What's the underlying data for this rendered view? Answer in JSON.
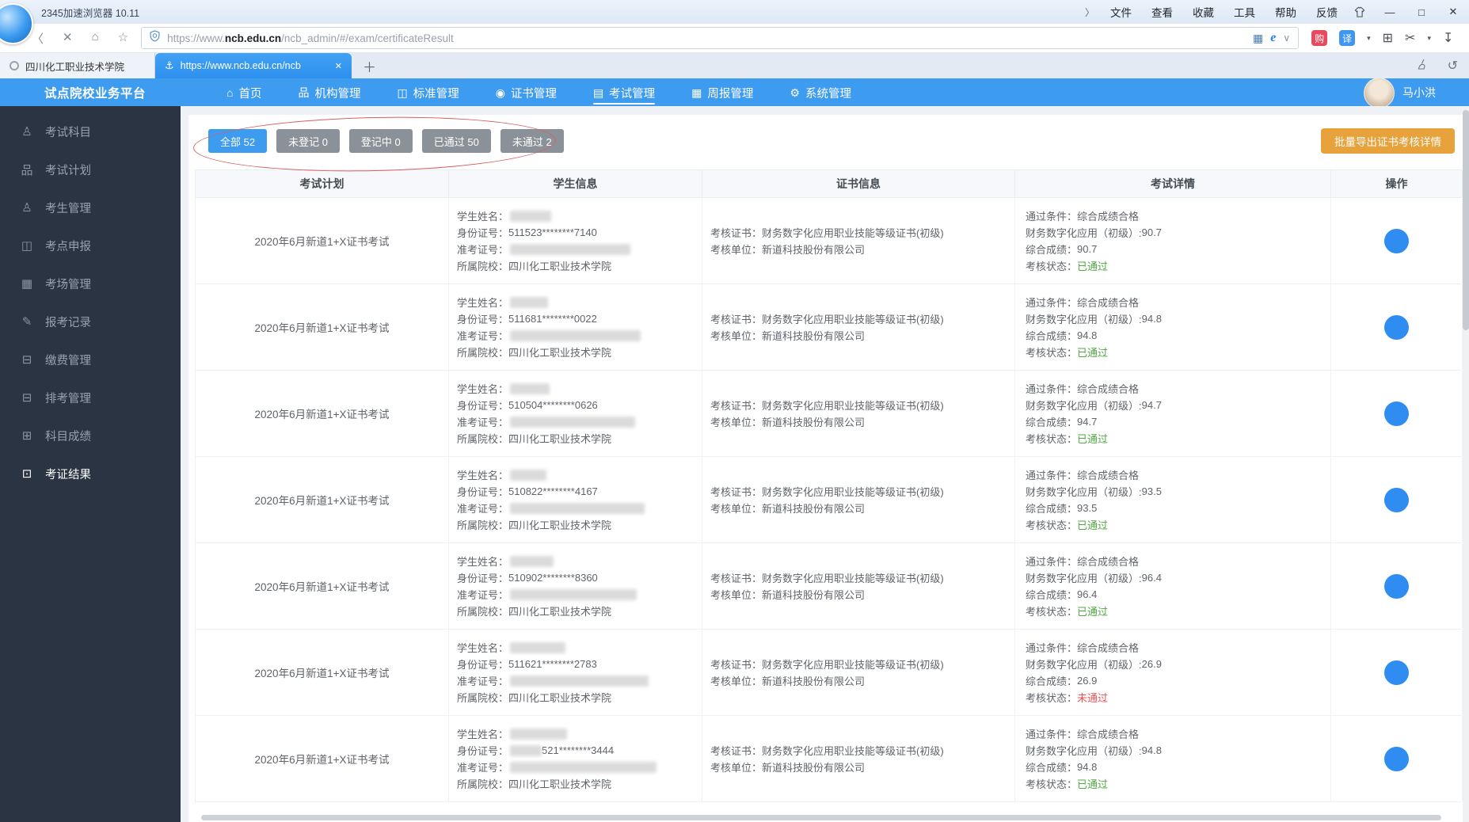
{
  "colors": {
    "accent": "#3d9bf0",
    "sidebar-bg": "#2b3442",
    "gray-btn": "#8b9198",
    "orange": "#e7a23c",
    "green": "#53a745",
    "red": "#f25050",
    "action": "#2f8df2",
    "annotation": "#d95f5f"
  },
  "browser": {
    "title": "2345加速浏览器 10.11",
    "menu_chevron": "〉",
    "menu_items": [
      "文件",
      "查看",
      "收藏",
      "工具",
      "帮助",
      "反馈"
    ],
    "window_controls": {
      "minimize": "—",
      "maximize": "□",
      "close": "✕"
    },
    "address": {
      "url_scheme": "https://www.",
      "url_domain": "ncb.edu.cn",
      "url_path": "/ncb_admin/#/exam/certificateResult"
    },
    "badges": {
      "buy": "购",
      "translate": "译"
    },
    "tabs": [
      {
        "title": "四川化工职业技术学院",
        "active": false,
        "closable": false
      },
      {
        "title": "https://www.ncb.edu.cn/ncb",
        "active": true,
        "closable": true
      }
    ]
  },
  "app": {
    "brand": "试点院校业务平台",
    "nav_items": [
      {
        "label": "首页",
        "icon": "home-icon",
        "active": false
      },
      {
        "label": "机构管理",
        "icon": "org-icon",
        "active": false
      },
      {
        "label": "标准管理",
        "icon": "standard-icon",
        "active": false
      },
      {
        "label": "证书管理",
        "icon": "certificate-icon",
        "active": false
      },
      {
        "label": "考试管理",
        "icon": "exam-icon",
        "active": true
      },
      {
        "label": "周报管理",
        "icon": "weekly-report-icon",
        "active": false
      },
      {
        "label": "系统管理",
        "icon": "gear-icon",
        "active": false
      }
    ],
    "user": {
      "name": "马小洪"
    }
  },
  "sidebar": {
    "items": [
      {
        "label": "考试科目",
        "icon": "user-icon",
        "active": false
      },
      {
        "label": "考试计划",
        "icon": "sitemap-icon",
        "active": false
      },
      {
        "label": "考生管理",
        "icon": "user-icon",
        "active": false
      },
      {
        "label": "考点申报",
        "icon": "book-icon",
        "active": false
      },
      {
        "label": "考场管理",
        "icon": "building-icon",
        "active": false
      },
      {
        "label": "报考记录",
        "icon": "user-edit-icon",
        "active": false
      },
      {
        "label": "缴费管理",
        "icon": "card-icon",
        "active": false
      },
      {
        "label": "排考管理",
        "icon": "card-icon",
        "active": false
      },
      {
        "label": "科目成绩",
        "icon": "grades-icon",
        "active": false
      },
      {
        "label": "考证结果",
        "icon": "board-icon",
        "active": true
      }
    ]
  },
  "filters": {
    "buttons": [
      {
        "label": "全部 52",
        "active": true
      },
      {
        "label": "未登记 0",
        "active": false
      },
      {
        "label": "登记中 0",
        "active": false
      },
      {
        "label": "已通过 50",
        "active": false
      },
      {
        "label": "未通过 2",
        "active": false
      }
    ]
  },
  "toolbar": {
    "export_label": "批量导出证书考核详情"
  },
  "table": {
    "headers": [
      "考试计划",
      "学生信息",
      "证书信息",
      "考试详情",
      "操作"
    ],
    "row_labels": {
      "name": "学生姓名：",
      "id": "身份证号：",
      "ticket": "准考证号：",
      "school": "所属院校：",
      "cert": "考核证书：",
      "org": "考核单位：",
      "condition": "通过条件： ",
      "subject": "财务数字化应用（初级）: ",
      "total": "综合成绩： ",
      "status": "考核状态："
    },
    "rows": [
      {
        "plan": "2020年6月新道1+X证书考试",
        "name_blur_w": 52,
        "id_prefix_blurred": false,
        "id_prefix_blur_w": 0,
        "id_number": "511523********7140",
        "ticket_blur_w": 152,
        "school": "四川化工职业技术学院",
        "cert": "财务数字化应用职业技能等级证书(初级)",
        "org": "新道科技股份有限公司",
        "pass_condition": "综合成绩合格",
        "subject_score": "90.7",
        "total_score": "90.7",
        "status": "已通过",
        "passed": true
      },
      {
        "plan": "2020年6月新道1+X证书考试",
        "name_blur_w": 48,
        "id_prefix_blurred": false,
        "id_prefix_blur_w": 0,
        "id_number": "511681********0022",
        "ticket_blur_w": 165,
        "school": "四川化工职业技术学院",
        "cert": "财务数字化应用职业技能等级证书(初级)",
        "org": "新道科技股份有限公司",
        "pass_condition": "综合成绩合格",
        "subject_score": "94.8",
        "total_score": "94.8",
        "status": "已通过",
        "passed": true
      },
      {
        "plan": "2020年6月新道1+X证书考试",
        "name_blur_w": 50,
        "id_prefix_blurred": false,
        "id_prefix_blur_w": 0,
        "id_number": "510504********0626",
        "ticket_blur_w": 158,
        "school": "四川化工职业技术学院",
        "cert": "财务数字化应用职业技能等级证书(初级)",
        "org": "新道科技股份有限公司",
        "pass_condition": "综合成绩合格",
        "subject_score": "94.7",
        "total_score": "94.7",
        "status": "已通过",
        "passed": true
      },
      {
        "plan": "2020年6月新道1+X证书考试",
        "name_blur_w": 46,
        "id_prefix_blurred": false,
        "id_prefix_blur_w": 0,
        "id_number": "510822********4167",
        "ticket_blur_w": 170,
        "school": "四川化工职业技术学院",
        "cert": "财务数字化应用职业技能等级证书(初级)",
        "org": "新道科技股份有限公司",
        "pass_condition": "综合成绩合格",
        "subject_score": "93.5",
        "total_score": "93.5",
        "status": "已通过",
        "passed": true
      },
      {
        "plan": "2020年6月新道1+X证书考试",
        "name_blur_w": 55,
        "id_prefix_blurred": false,
        "id_prefix_blur_w": 0,
        "id_number": "510902********8360",
        "ticket_blur_w": 160,
        "school": "四川化工职业技术学院",
        "cert": "财务数字化应用职业技能等级证书(初级)",
        "org": "新道科技股份有限公司",
        "pass_condition": "综合成绩合格",
        "subject_score": "96.4",
        "total_score": "96.4",
        "status": "已通过",
        "passed": true
      },
      {
        "plan": "2020年6月新道1+X证书考试",
        "name_blur_w": 70,
        "id_prefix_blurred": false,
        "id_prefix_blur_w": 0,
        "id_number": "511621********2783",
        "ticket_blur_w": 175,
        "school": "四川化工职业技术学院",
        "cert": "财务数字化应用职业技能等级证书(初级)",
        "org": "新道科技股份有限公司",
        "pass_condition": "综合成绩合格",
        "subject_score": "26.9",
        "total_score": "26.9",
        "status": "未通过",
        "passed": false
      },
      {
        "plan": "2020年6月新道1+X证书考试",
        "name_blur_w": 72,
        "id_prefix_blurred": true,
        "id_prefix_blur_w": 40,
        "id_number": "521********3444",
        "ticket_blur_w": 185,
        "school": "四川化工职业技术学院",
        "cert": "财务数字化应用职业技能等级证书(初级)",
        "org": "新道科技股份有限公司",
        "pass_condition": "综合成绩合格",
        "subject_score": "94.8",
        "total_score": "94.8",
        "status": "已通过",
        "passed": true
      }
    ]
  },
  "icon_glyphs": {
    "back-icon": "〈",
    "stop-icon": "✕",
    "home-button-icon": "⌂",
    "star-icon": "☆",
    "qr-code-icon": "▦",
    "chevron-down-icon": "∨",
    "caret-down-icon": "▾",
    "split-screen-icon": "⊞",
    "scissors-icon": "✂",
    "download-icon": "↧",
    "plus-icon": "＋",
    "undo-icon": "↺",
    "anchor-favicon": "⚓",
    "home-icon": "⌂",
    "org-icon": "品",
    "standard-icon": "◫",
    "certificate-icon": "◉",
    "exam-icon": "▤",
    "weekly-report-icon": "▦",
    "gear-icon": "⚙",
    "user-icon": "♙",
    "sitemap-icon": "品",
    "book-icon": "◫",
    "building-icon": "▦",
    "user-edit-icon": "✎",
    "card-icon": "⊟",
    "grades-icon": "⊞",
    "board-icon": "⊡"
  }
}
